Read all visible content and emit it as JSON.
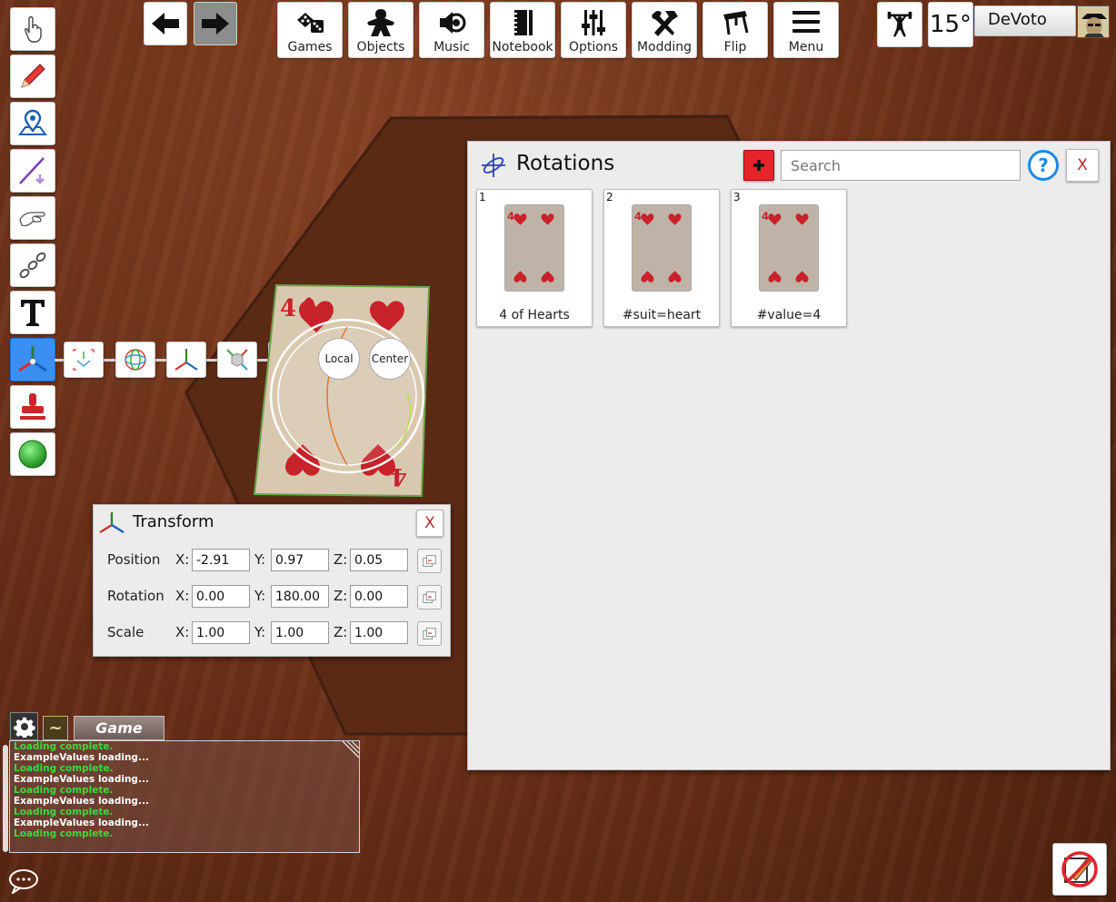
{
  "top_toolbar": {
    "nav_back_label": "back",
    "nav_forward_label": "forward",
    "buttons": [
      {
        "label": "Games",
        "icon": "dice-icon"
      },
      {
        "label": "Objects",
        "icon": "meeple-icon"
      },
      {
        "label": "Music",
        "icon": "speaker-icon"
      },
      {
        "label": "Notebook",
        "icon": "notebook-icon"
      },
      {
        "label": "Options",
        "icon": "sliders-icon"
      },
      {
        "label": "Modding",
        "icon": "hammer-wrench-icon"
      },
      {
        "label": "Flip",
        "icon": "flip-table-icon"
      },
      {
        "label": "Menu",
        "icon": "hamburger-icon"
      }
    ],
    "rotation_step": "15°",
    "player_name": "DeVoto"
  },
  "left_toolbar": {
    "tools": [
      "grab-hand-icon",
      "pencil-icon",
      "map-pin-icon",
      "line-tool-icon",
      "flick-icon",
      "joint-chain-icon",
      "text-tool-icon",
      "gizmo-icon",
      "stamp-icon",
      "green-ball-icon"
    ],
    "gizmo_options": {
      "local_label": "Local",
      "center_label": "Center"
    }
  },
  "rotations_panel": {
    "title": "Rotations",
    "search_placeholder": "Search",
    "close_label": "X",
    "cards": [
      {
        "index": "1",
        "name": "4 of Hearts",
        "rank": "4"
      },
      {
        "index": "2",
        "name": "#suit=heart",
        "rank": "4"
      },
      {
        "index": "3",
        "name": "#value=4",
        "rank": "4"
      }
    ]
  },
  "table_card": {
    "rank": "4"
  },
  "transform_panel": {
    "title": "Transform",
    "close_label": "X",
    "rows": [
      {
        "label": "Position",
        "x": "-2.91",
        "y": "0.97",
        "z": "0.05"
      },
      {
        "label": "Rotation",
        "x": "0.00",
        "y": "180.00",
        "z": "0.00"
      },
      {
        "label": "Scale",
        "x": "1.00",
        "y": "1.00",
        "z": "1.00"
      }
    ],
    "axis_labels": {
      "x": "X:",
      "y": "Y:",
      "z": "Z:"
    }
  },
  "chat": {
    "tilde_label": "~",
    "tab_label": "Game",
    "lines": [
      {
        "text": "Loading complete.",
        "color": "#3fd63f"
      },
      {
        "text": "ExampleValues loading...",
        "color": "#ffffff"
      },
      {
        "text": "Loading complete.",
        "color": "#3fd63f"
      },
      {
        "text": "ExampleValues loading...",
        "color": "#ffffff"
      },
      {
        "text": "Loading complete.",
        "color": "#3fd63f"
      },
      {
        "text": "ExampleValues loading...",
        "color": "#ffffff"
      },
      {
        "text": "Loading complete.",
        "color": "#3fd63f"
      },
      {
        "text": "ExampleValues loading...",
        "color": "#ffffff"
      },
      {
        "text": "Loading complete.",
        "color": "#3fd63f"
      }
    ]
  },
  "colors": {
    "accent_blue": "#3b8ef2",
    "heart_red": "#c8222a",
    "add_red": "#e8242b",
    "help_blue": "#1e88e5"
  }
}
